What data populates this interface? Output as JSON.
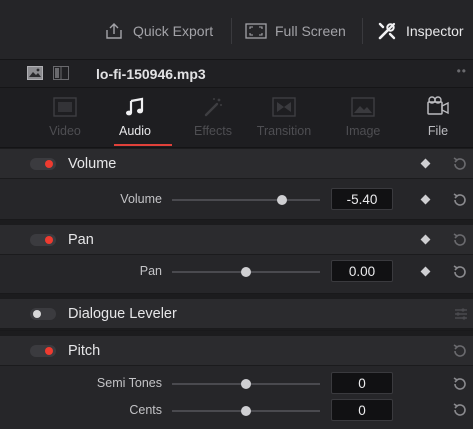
{
  "toolbar": {
    "quick_export": "Quick Export",
    "full_screen": "Full Screen",
    "inspector": "Inspector"
  },
  "file": {
    "name": "lo-fi-150946.mp3"
  },
  "tabs": [
    {
      "label": "Video",
      "state": "disabled"
    },
    {
      "label": "Audio",
      "state": "active"
    },
    {
      "label": "Effects",
      "state": "disabled"
    },
    {
      "label": "Transition",
      "state": "disabled"
    },
    {
      "label": "Image",
      "state": "disabled"
    },
    {
      "label": "File",
      "state": "enabled"
    }
  ],
  "sections": {
    "volume": {
      "title": "Volume",
      "enabled": true,
      "param_label": "Volume",
      "value": "-5.40",
      "slider_fraction": 0.74
    },
    "pan": {
      "title": "Pan",
      "enabled": true,
      "param_label": "Pan",
      "value": "0.00",
      "slider_fraction": 0.5
    },
    "dialogue": {
      "title": "Dialogue Leveler",
      "enabled": false
    },
    "pitch": {
      "title": "Pitch",
      "enabled": true,
      "semi_label": "Semi Tones",
      "semi_value": "0",
      "semi_fraction": 0.5,
      "cents_label": "Cents",
      "cents_value": "0",
      "cents_fraction": 0.5
    }
  },
  "colors": {
    "accent": "#ee3b30",
    "background": "#1c1c1e",
    "panel": "#262629"
  }
}
